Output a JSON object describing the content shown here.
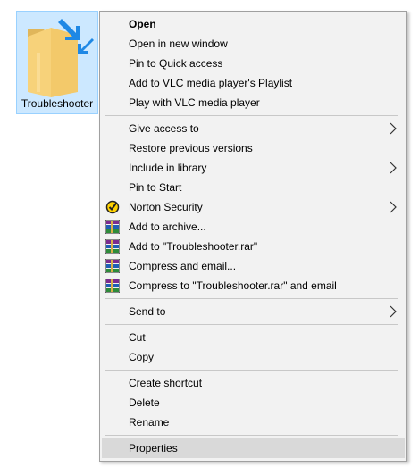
{
  "desktop": {
    "folder_label": "Troubleshooter",
    "folder_icon": "folder-shortcut-icon"
  },
  "colors": {
    "selection_fill": "#cce8ff",
    "menu_background": "#f2f2f2",
    "highlight": "#d9d9d9"
  },
  "context_menu": {
    "group1": {
      "open": "Open",
      "open_new_window": "Open in new window",
      "pin_quick_access": "Pin to Quick access",
      "add_vlc_playlist": "Add to VLC media player's Playlist",
      "play_vlc": "Play with VLC media player"
    },
    "group2": {
      "give_access": "Give access to",
      "restore_versions": "Restore previous versions",
      "include_library": "Include in library",
      "pin_start": "Pin to Start",
      "norton": "Norton Security",
      "add_archive": "Add to archive...",
      "add_rar": "Add to \"Troubleshooter.rar\"",
      "compress_email": "Compress and email...",
      "compress_rar_email": "Compress to \"Troubleshooter.rar\" and email"
    },
    "group3": {
      "send_to": "Send to"
    },
    "group4": {
      "cut": "Cut",
      "copy": "Copy"
    },
    "group5": {
      "create_shortcut": "Create shortcut",
      "delete": "Delete",
      "rename": "Rename"
    },
    "group6": {
      "properties": "Properties"
    },
    "icons": {
      "norton": "norton-check-icon",
      "winrar": "winrar-books-icon",
      "submenu": "chevron-right-icon"
    }
  }
}
